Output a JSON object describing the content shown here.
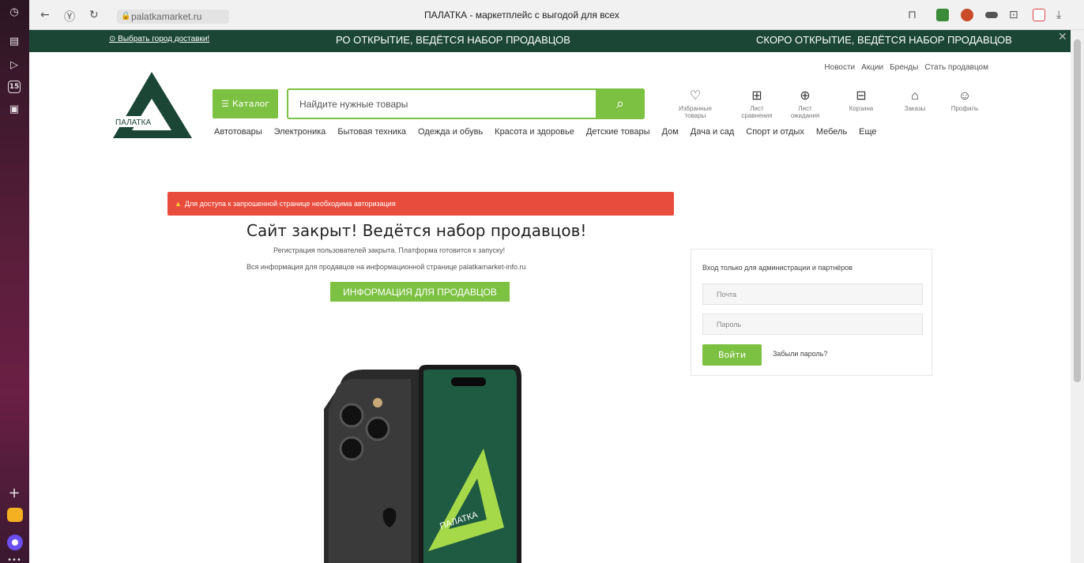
{
  "browser": {
    "url": "palatkamarket.ru",
    "tab_title": "ПАЛАТКА - маркетплейс с выгодой для всех"
  },
  "sidebar": {
    "calendar_badge": "15"
  },
  "strip": {
    "city_link": "Выбрать город доставки!",
    "ticker_1": "РО ОТКРЫТИЕ, ВЕДЁТСЯ НАБОР ПРОДАВЦОВ",
    "ticker_2": "СКОРО ОТКРЫТИЕ, ВЕДЁТСЯ НАБОР ПРОДАВЦОВ"
  },
  "top_links": [
    "Новости",
    "Акции",
    "Бренды",
    "Стать продавцом"
  ],
  "logo": {
    "text": "ПАЛАТКА",
    "color": "#1b4636"
  },
  "catalog_label": "Каталог",
  "search": {
    "placeholder": "Найдите нужные товары"
  },
  "header_icons": {
    "favorites": "Избранные товары",
    "compare": "Лист сравнения",
    "wishlist": "Лист ожидания",
    "cart": "Корзина",
    "orders": "Заказы",
    "profile": "Профиль"
  },
  "categories": [
    "Автотовары",
    "Электроника",
    "Бытовая техника",
    "Одежда и обувь",
    "Красота и здоровье",
    "Детские товары",
    "Дом",
    "Дача и сад",
    "Спорт и отдых",
    "Мебель",
    "Еще"
  ],
  "alert": "Для доступа к запрошенной странице необходима авторизация",
  "main": {
    "headline": "Сайт закрыт! Ведётся набор продавцов!",
    "line1": "Регистрация пользователей закрыта. Платформа готовится к запуску!",
    "line2": "Вся информация для продавцов на информационной странице palatkamarket-info.ru",
    "sellers_button": "ИНФОРМАЦИЯ ДЛЯ ПРОДАВЦОВ"
  },
  "login": {
    "title": "Вход только для администрации и партнёров",
    "email_placeholder": "Почта",
    "password_placeholder": "Пароль",
    "submit": "Войти",
    "forgot": "Забыли пароль?"
  },
  "phone_logo_text": "ПАЛАТКА",
  "colors": {
    "accent": "#7cc142",
    "brand_dark": "#1b4636",
    "alert": "#e84c3d"
  }
}
